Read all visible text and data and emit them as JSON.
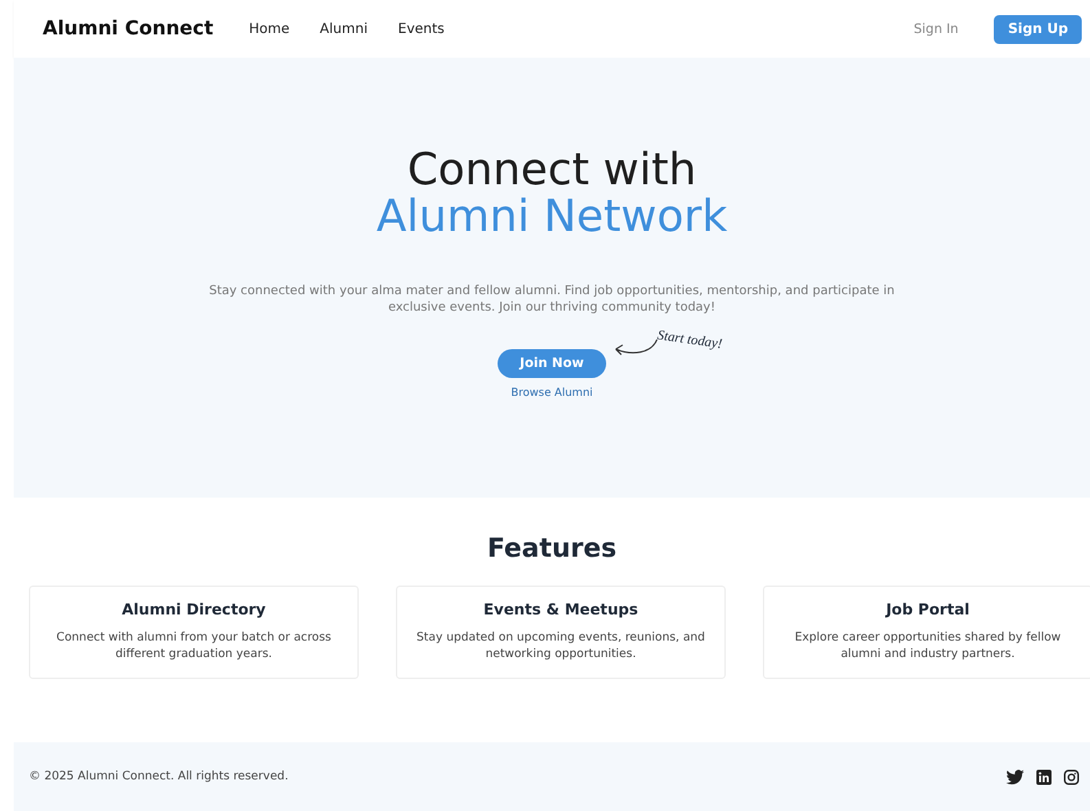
{
  "header": {
    "brand": "Alumni Connect",
    "nav": [
      "Home",
      "Alumni",
      "Events"
    ],
    "sign_in": "Sign In",
    "sign_up": "Sign Up"
  },
  "hero": {
    "title_line1": "Connect with",
    "title_line2": "Alumni Network",
    "description": "Stay connected with your alma mater and fellow alumni. Find job opportunities, mentorship, and participate in exclusive events. Join our thriving community today!",
    "primary_button": "Join Now",
    "callout": "Start today!",
    "secondary_link": "Browse Alumni"
  },
  "features": {
    "title": "Features",
    "cards": [
      {
        "title": "Alumni Directory",
        "text": "Connect with alumni from your batch or across different graduation years."
      },
      {
        "title": "Events & Meetups",
        "text": "Stay updated on upcoming events, reunions, and networking opportunities."
      },
      {
        "title": "Job Portal",
        "text": "Explore career opportunities shared by fellow alumni and industry partners."
      }
    ]
  },
  "footer": {
    "copyright": "© 2025 Alumni Connect. All rights reserved."
  }
}
